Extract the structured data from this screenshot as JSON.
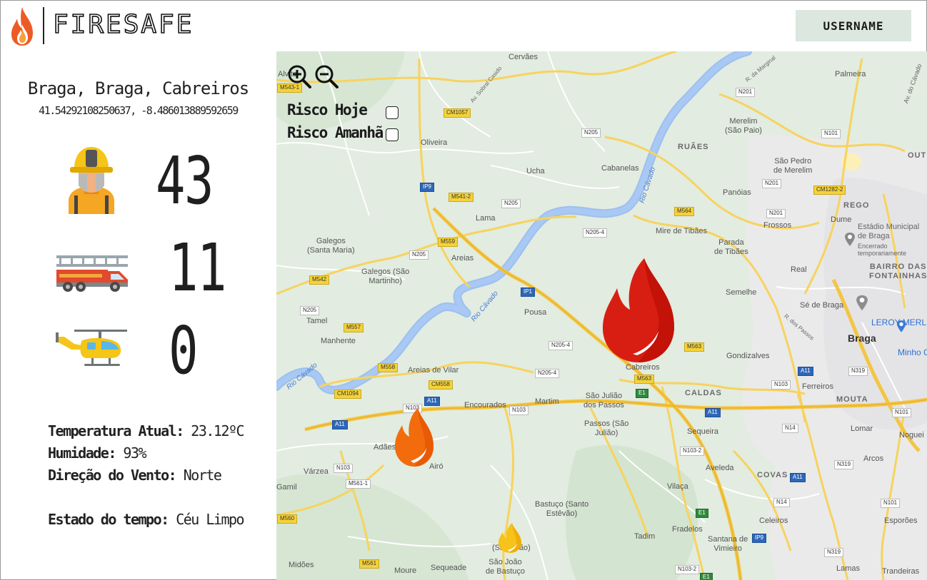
{
  "app": {
    "name": "FIRESAFE"
  },
  "header": {
    "username_label": "USERNAME"
  },
  "location": {
    "name": "Braga, Braga, Cabreiros",
    "coords": "41.54292108250637, -8.486013889592659"
  },
  "resources": {
    "firefighters": 43,
    "fire_trucks": 11,
    "helicopters": 0
  },
  "weather": {
    "temp_label": "Temperatura Atual:",
    "temp_value": "23.12ºC",
    "humidity_label": "Humidade:",
    "humidity_value": "93%",
    "wind_label": "Direção do Vento:",
    "wind_value": "Norte",
    "state_label": "Estado do tempo:",
    "state_value": "Céu Limpo"
  },
  "map": {
    "risk_today_label": "Risco Hoje",
    "risk_tomorrow_label": "Risco Amanhã",
    "places": {
      "cervaes": "Cervães",
      "palmeira": "Palmeira",
      "alvito": "Alvito",
      "oliveira": "Oliveira",
      "merelim_sp": "Merelim\n(São Paio)",
      "ruaes": "RUÃES",
      "ucha": "Ucha",
      "cabanelas": "Cabanelas",
      "sao_pedro_merelim": "São Pedro\nde Merelim",
      "panoias": "Panóias",
      "rego": "REGO",
      "frossos": "Frossos",
      "dume": "Dume",
      "lama": "Lama",
      "mire_tibaes": "Mire de Tibães",
      "parada_tibaes": "Parada\nde Tibães",
      "galegos_sm": "Galegos\n(Santa Maria)",
      "galegos_sao_martinho": "Galegos (São\nMartinho)",
      "areias": "Areias",
      "real": "Real",
      "bairro": "BAIRRO DAS\nFONTAINHAS",
      "semelhe": "Semelhe",
      "tamel": "Tamel",
      "pousa": "Pousa",
      "se_braga": "Sé de Braga",
      "leroy": "LEROY MERLIN",
      "braga": "Braga",
      "manhente": "Manhente",
      "gondizalves": "Gondizalves",
      "minho": "Minho C",
      "areias_vilar": "Areias de Vilar",
      "cabreiros": "Cabreiros",
      "caldas": "CALDAS",
      "ferreiros": "Ferreiros",
      "sao_juliao": "São Julião\ndos Passos",
      "martim": "Martim",
      "encourados": "Encourados",
      "moura": "MOUTA",
      "passos": "Passos (São\nJulião)",
      "sequeira": "Sequeira",
      "lomar": "Lomar",
      "nogueira": "Noguei",
      "adaes": "Adães",
      "airo": "Airó",
      "arcos": "Arcos",
      "varzea": "Várzea",
      "aveleda": "Aveleda",
      "covas": "COVAS",
      "gamil": "Gamil",
      "vilaca": "Vilaça",
      "bastuco_se": "Bastuço (Santo\nEstêvão)",
      "celeiros": "Celeiros",
      "esporoes": "Esporões",
      "tadim": "Tadim",
      "fradelos": "Fradelos",
      "santana": "Santana de\nVimieiro",
      "sao_joao": "(São João)",
      "bastuco_sj": "São João\nde Bastuço",
      "midoes": "Midões",
      "moure": "Moure",
      "sequeade": "Sequeade",
      "lamas": "Lamas",
      "trandeiras": "Trandeiras",
      "outer": "OUTE",
      "estadio": "Estádio Municipal\nde Braga",
      "encerrado": "Encerrado\ntemporariamente",
      "rio_cavado1": "Rio Cávado",
      "rio_cavado2": "Rio Cávado",
      "rio_cavado3": "Rio Cávado",
      "av_cavado": "Av. do Cávado",
      "r_marginal": "R. da Marginal",
      "av_sobral": "Av. Sobral Casido",
      "rua_dos_passos": "R. dos Passos"
    },
    "roads": {
      "m543": "M543-1",
      "cm1057": "CM1057",
      "n201a": "N201",
      "n205a": "N205",
      "n101a": "N101",
      "ip9a": "IP9",
      "m5412": "M541-2",
      "n205b": "N205",
      "n201b": "N201",
      "cm1282": "CM1282-2",
      "m564": "M564",
      "n201c": "N201",
      "n2054": "N205-4",
      "n205c": "N205",
      "m559": "M559",
      "m542": "M542",
      "ip1": "IP1",
      "n205d": "N205",
      "m557": "M557",
      "n2054b": "N205-4",
      "m563": "M563",
      "m558": "M558",
      "n2054c": "N205-4",
      "cm558": "CM558",
      "m563b": "M563",
      "a11a": "A11",
      "n319a": "N319",
      "cm1094": "CM1094",
      "e1a": "E1",
      "n103a": "N103",
      "n103b": "N103",
      "a11b": "A11",
      "n103c": "N103",
      "a11c": "A11",
      "n101b": "N101",
      "a11d": "A11",
      "n14a": "N14",
      "n1032": "N103-2",
      "n103d": "N103",
      "n5611": "M561-1",
      "a11e": "A11",
      "n319b": "N319",
      "m560": "M560",
      "e1b": "E1",
      "n14b": "N14",
      "n101c": "N101",
      "ip9b": "IP9",
      "m561": "M561",
      "n319c": "N319",
      "n1032b": "N103-2",
      "e1c": "E1"
    }
  }
}
